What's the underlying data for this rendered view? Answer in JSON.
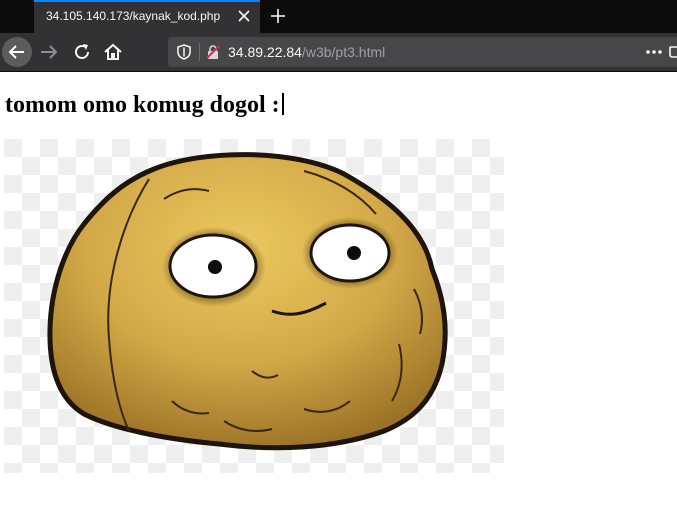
{
  "browser": {
    "tab": {
      "title": "34.105.140.173/kaynak_kod.php"
    },
    "url": {
      "host": "34.89.22.84",
      "path": "/w3b/pt3.html"
    },
    "icons": {
      "back": "back-arrow-icon",
      "forward": "forward-arrow-icon",
      "reload": "reload-icon",
      "home": "home-icon",
      "shield": "tracking-shield-icon",
      "lock": "insecure-lock-icon",
      "menu": "more-actions-icon",
      "close": "close-icon",
      "newtab": "plus-icon"
    }
  },
  "page": {
    "heading": "tomom omo komug dogol :"
  },
  "colors": {
    "tab_accent": "#0a84ff",
    "toolbar": "#323234",
    "urlbar": "#474749",
    "potato": "#d4aa4c"
  }
}
